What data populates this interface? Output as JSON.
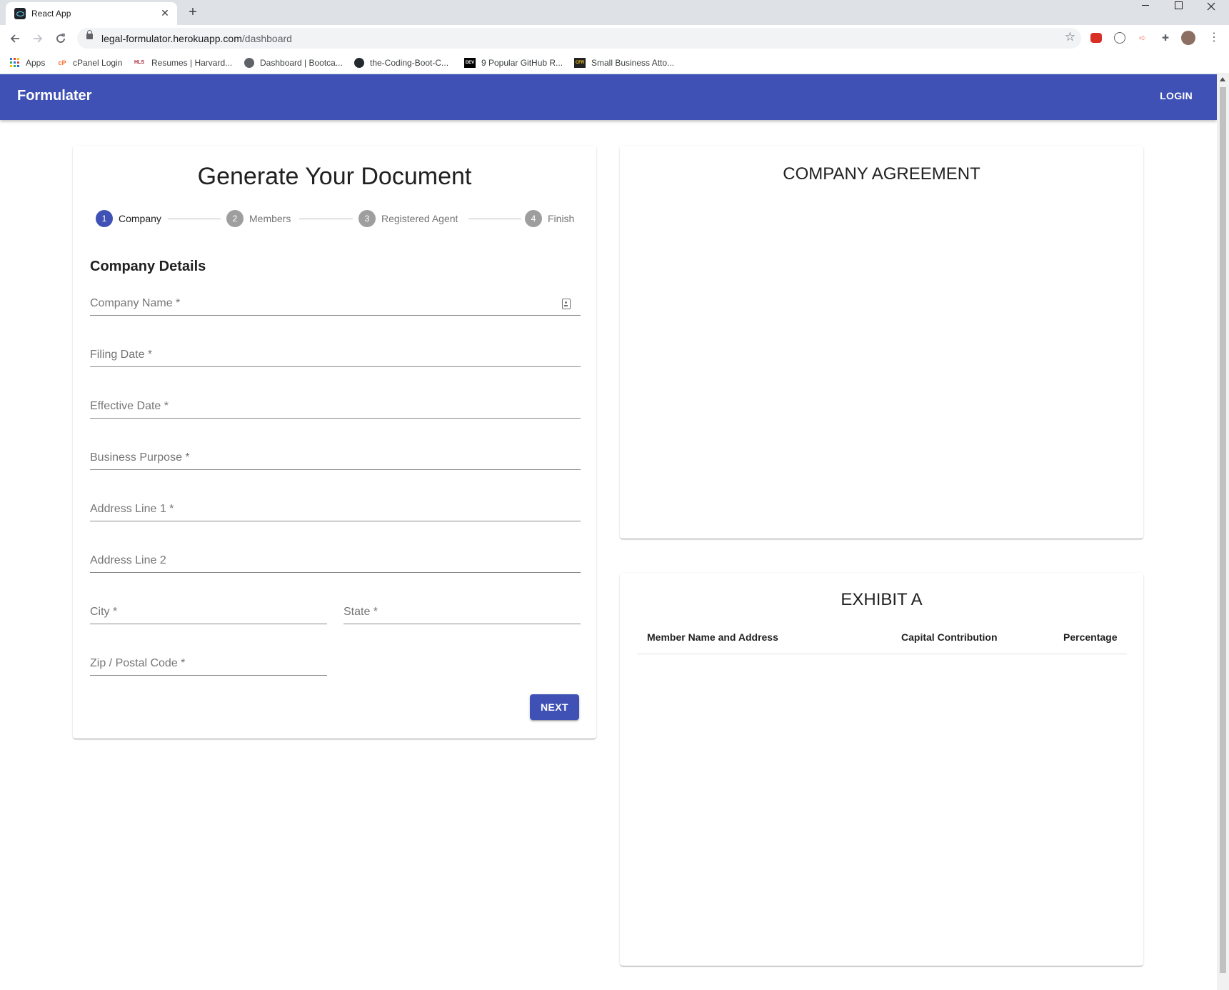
{
  "browser": {
    "tab_title": "React App",
    "tab_close_glyph": "✕",
    "new_tab_glyph": "+",
    "url_host": "legal-formulator.herokuapp.com",
    "url_path": "/dashboard",
    "bookmarks": [
      {
        "label": "Apps",
        "icon": "apps-grid-icon"
      },
      {
        "label": "cPanel Login",
        "icon": "cpanel-icon"
      },
      {
        "label": "Resumes | Harvard...",
        "icon": "harvard-icon"
      },
      {
        "label": "Dashboard | Bootca...",
        "icon": "globe-icon"
      },
      {
        "label": "the-Coding-Boot-C...",
        "icon": "github-icon"
      },
      {
        "label": "9 Popular GitHub R...",
        "icon": "dev-icon"
      },
      {
        "label": "Small Business Atto...",
        "icon": "cfr-icon"
      }
    ]
  },
  "app": {
    "brand": "Formulater",
    "login_label": "LOGIN"
  },
  "form": {
    "title": "Generate Your Document",
    "steps": [
      {
        "number": "1",
        "label": "Company",
        "active": true
      },
      {
        "number": "2",
        "label": "Members",
        "active": false
      },
      {
        "number": "3",
        "label": "Registered Agent",
        "active": false
      },
      {
        "number": "4",
        "label": "Finish",
        "active": false
      }
    ],
    "section_title": "Company Details",
    "fields": {
      "company_name": {
        "label": "Company Name *",
        "value": ""
      },
      "filing_date": {
        "label": "Filing Date *",
        "value": ""
      },
      "effective_date": {
        "label": "Effective Date *",
        "value": ""
      },
      "business_purpose": {
        "label": "Business Purpose *",
        "value": ""
      },
      "address_line_1": {
        "label": "Address Line 1 *",
        "value": ""
      },
      "address_line_2": {
        "label": "Address Line 2",
        "value": ""
      },
      "city": {
        "label": "City *",
        "value": ""
      },
      "state": {
        "label": "State *",
        "value": ""
      },
      "zip": {
        "label": "Zip / Postal Code *",
        "value": ""
      }
    },
    "next_label": "NEXT"
  },
  "agreement": {
    "title": "COMPANY AGREEMENT"
  },
  "exhibit": {
    "title": "EXHIBIT A",
    "columns": [
      "Member Name and Address",
      "Capital Contribution",
      "Percentage"
    ]
  },
  "colors": {
    "primary": "#3f51b5",
    "inactive_step": "#9e9e9e"
  }
}
